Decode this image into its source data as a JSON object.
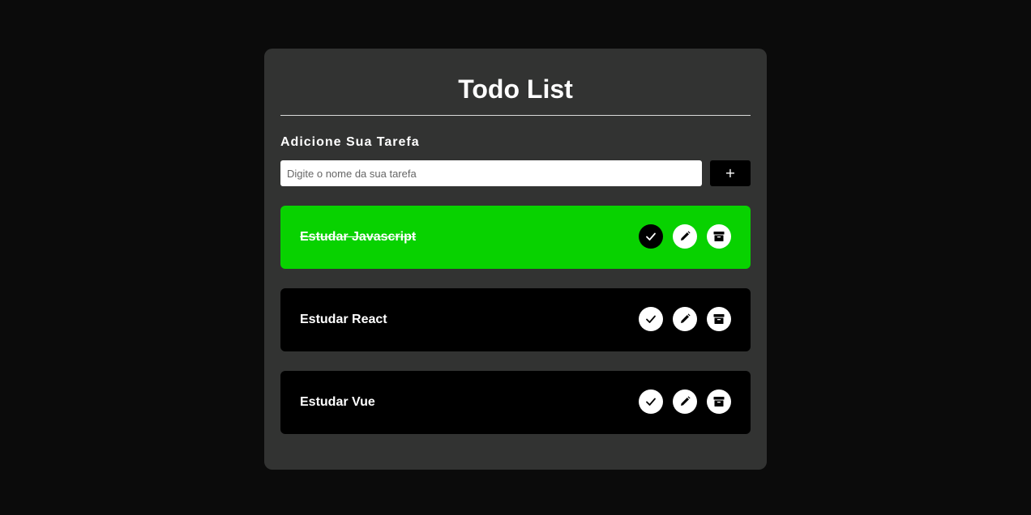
{
  "header": {
    "title": "Todo List"
  },
  "form": {
    "label": "Adicione Sua Tarefa",
    "input_placeholder": "Digite o nome da sua tarefa",
    "input_value": "",
    "add_button_label": "+"
  },
  "todos": [
    {
      "text": "Estudar Javascript",
      "done": true
    },
    {
      "text": "Estudar React",
      "done": false
    },
    {
      "text": "Estudar Vue",
      "done": false
    }
  ],
  "icons": {
    "complete": "check-icon",
    "edit": "pencil-icon",
    "remove": "archive-icon"
  },
  "colors": {
    "page_background": "#0b0b0b",
    "card_background": "#323332",
    "done_background": "#08d200",
    "todo_background": "#000000",
    "button_background": "#ffffff"
  }
}
